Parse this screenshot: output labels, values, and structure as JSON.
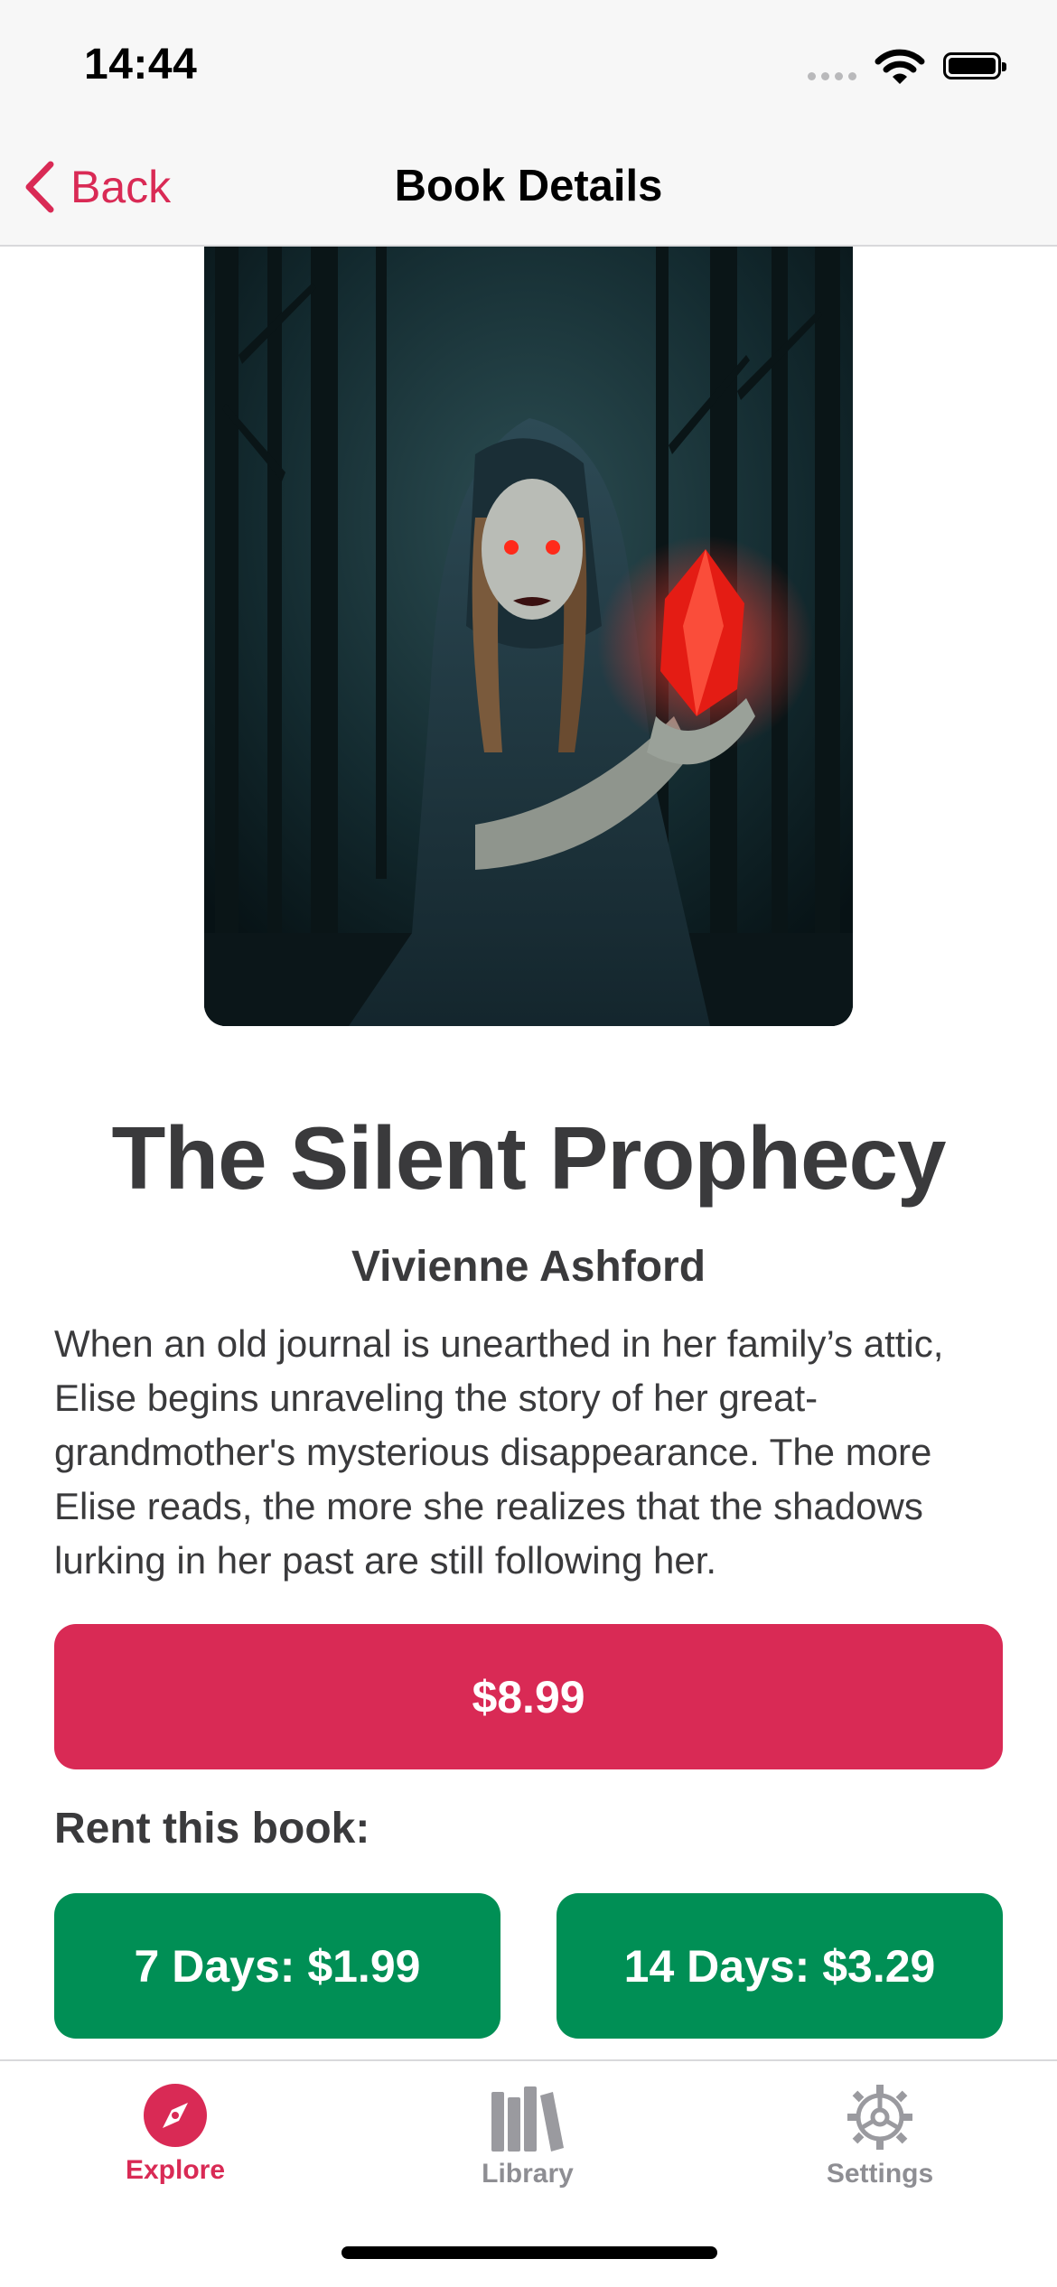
{
  "status_bar": {
    "time": "14:44"
  },
  "nav": {
    "back_label": "Back",
    "title": "Book Details"
  },
  "book": {
    "title": "The Silent Prophecy",
    "author": "Vivienne Ashford",
    "description": "When an old journal is unearthed in her family’s attic, Elise begins unraveling the story of her great-grandmother's mysterious disappearance. The more Elise reads, the more she realizes that the shadows lurking in her past are still following her.",
    "price_label": "$8.99"
  },
  "rent": {
    "heading": "Rent this book:",
    "options": [
      {
        "label": "7 Days: $1.99"
      },
      {
        "label": "14 Days: $3.29"
      }
    ]
  },
  "tab_bar": {
    "tabs": [
      {
        "label": "Explore",
        "icon": "compass-icon",
        "active": true
      },
      {
        "label": "Library",
        "icon": "books-icon",
        "active": false
      },
      {
        "label": "Settings",
        "icon": "gear-icon",
        "active": false
      }
    ]
  },
  "colors": {
    "accent": "#d92a55",
    "rent_green": "#008f55",
    "text": "#3a3a3c",
    "inactive_tab": "#8e8e93"
  }
}
